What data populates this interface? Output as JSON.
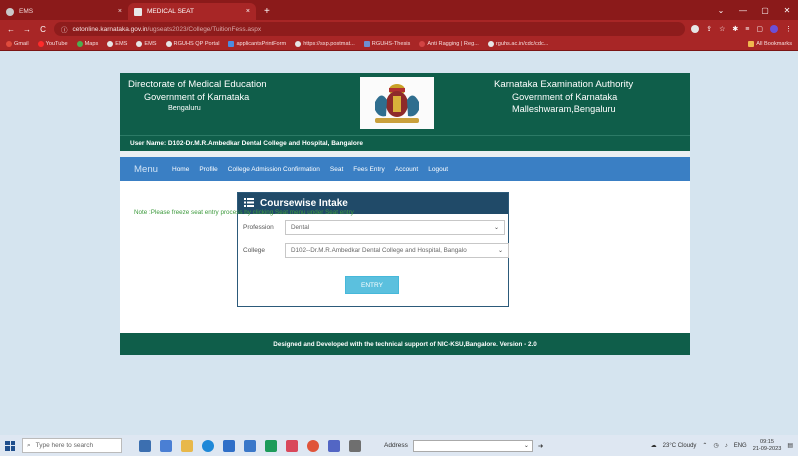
{
  "browser": {
    "tabs": [
      {
        "title": "EMS",
        "close": "×"
      },
      {
        "title": "MEDICAL SEAT",
        "close": "×"
      }
    ],
    "new_tab": "+",
    "window_controls": [
      "⌄",
      "—",
      "▢",
      "✕"
    ],
    "url_host": "cetonline.karnataka.gov.in",
    "url_path": "/ugseats2023/College/TuitionFess.aspx",
    "bookmarks": [
      "Gmail",
      "YouTube",
      "Maps",
      "EMS",
      "EMS",
      "RGUHS QP Portal",
      "applicantsPrintForm",
      "https://ssp.postmat...",
      "RGUHS-Thesis",
      "Anti Ragging | Reg...",
      "rguhs.ac.in/cdc/cdc..."
    ],
    "all_bookmarks": "All Bookmarks"
  },
  "header": {
    "left_line1": "Directorate of Medical Education",
    "left_line2": "Government of Karnataka",
    "left_line3": "Bengaluru",
    "right_line1": "Karnataka Examination Authority",
    "right_line2": "Government of Karnataka",
    "right_line3": "Malleshwaram,Bengaluru",
    "user": "User Name: D102-Dr.M.R.Ambedkar Dental College and Hospital, Bangalore"
  },
  "menu": {
    "title": "Menu",
    "items": [
      "Home",
      "Profile",
      "College Admission Confirmation",
      "Seat",
      "Fees Entry",
      "Account",
      "Logout"
    ]
  },
  "panel": {
    "title": "Coursewise Intake",
    "profession_label": "Profession",
    "profession_value": "Dental",
    "college_label": "College",
    "college_value": "D102--Dr.M.R.Ambedkar Dental College and Hospital, Bangalo",
    "entry_button": "ENTRY"
  },
  "note": "Note :Please freeze seat entry process by clicking Seat menu under Seat entry",
  "footer": "Designed and Developed with the technical support of  NIC-KSU,Bangalore.  Version - 2.0",
  "taskbar": {
    "search_placeholder": "Type here to search",
    "address_label": "Address",
    "weather": "23°C  Cloudy",
    "language": "ENG",
    "time": "09:15",
    "date": "21-09-2023"
  }
}
